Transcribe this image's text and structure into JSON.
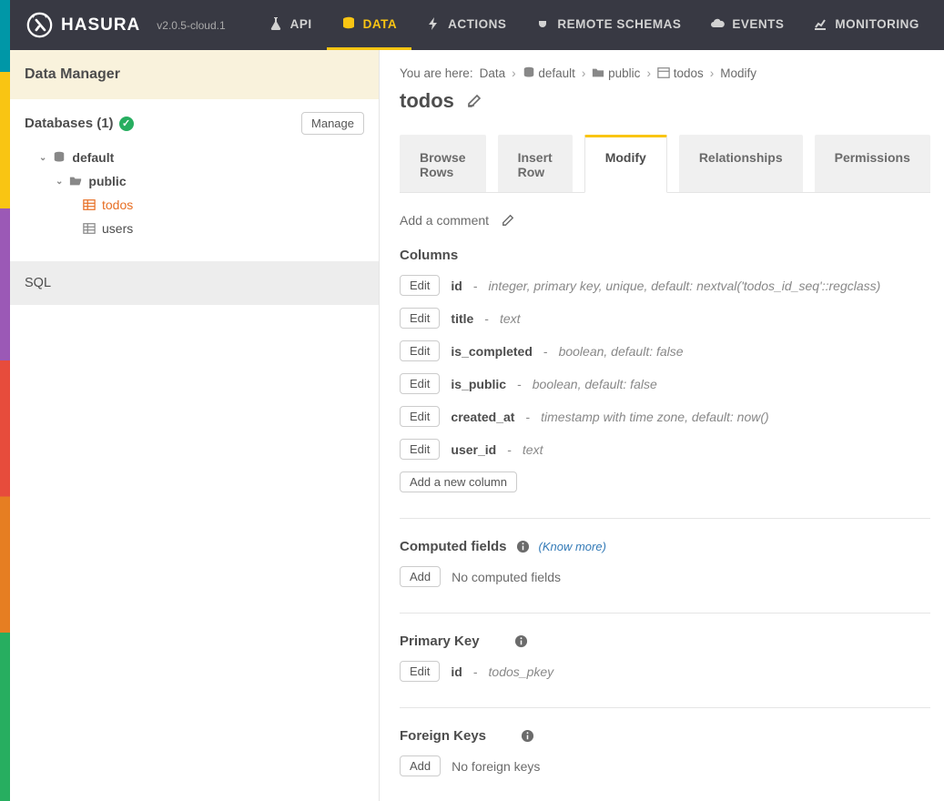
{
  "header": {
    "brand": "HASURA",
    "version": "v2.0.5-cloud.1",
    "nav": [
      {
        "label": "API",
        "icon": "flask"
      },
      {
        "label": "DATA",
        "icon": "database",
        "active": true
      },
      {
        "label": "ACTIONS",
        "icon": "bolt"
      },
      {
        "label": "REMOTE SCHEMAS",
        "icon": "plug"
      },
      {
        "label": "EVENTS",
        "icon": "cloud"
      },
      {
        "label": "MONITORING",
        "icon": "chart"
      }
    ]
  },
  "sidebar": {
    "title": "Data Manager",
    "databases_label": "Databases (1)",
    "manage_label": "Manage",
    "tree": {
      "db": "default",
      "schema": "public",
      "tables": [
        {
          "name": "todos",
          "active": true
        },
        {
          "name": "users",
          "active": false
        }
      ]
    },
    "sql_label": "SQL"
  },
  "breadcrumb": {
    "prefix": "You are here:",
    "parts": [
      "Data",
      "default",
      "public",
      "todos",
      "Modify"
    ]
  },
  "page": {
    "title": "todos",
    "tabs": [
      "Browse Rows",
      "Insert Row",
      "Modify",
      "Relationships",
      "Permissions"
    ],
    "active_tab": "Modify",
    "add_comment": "Add a comment",
    "columns": {
      "title": "Columns",
      "edit_label": "Edit",
      "add_new": "Add a new column",
      "items": [
        {
          "name": "id",
          "detail": "integer, primary key, unique, default: nextval('todos_id_seq'::regclass)"
        },
        {
          "name": "title",
          "detail": "text"
        },
        {
          "name": "is_completed",
          "detail": "boolean, default: false"
        },
        {
          "name": "is_public",
          "detail": "boolean, default: false"
        },
        {
          "name": "created_at",
          "detail": "timestamp with time zone, default: now()"
        },
        {
          "name": "user_id",
          "detail": "text"
        }
      ]
    },
    "computed": {
      "title": "Computed fields",
      "know_more": "(Know more)",
      "add_label": "Add",
      "empty": "No computed fields"
    },
    "primary_key": {
      "title": "Primary Key",
      "edit_label": "Edit",
      "name": "id",
      "detail": "todos_pkey"
    },
    "foreign_keys": {
      "title": "Foreign Keys",
      "add_label": "Add",
      "empty": "No foreign keys"
    }
  }
}
